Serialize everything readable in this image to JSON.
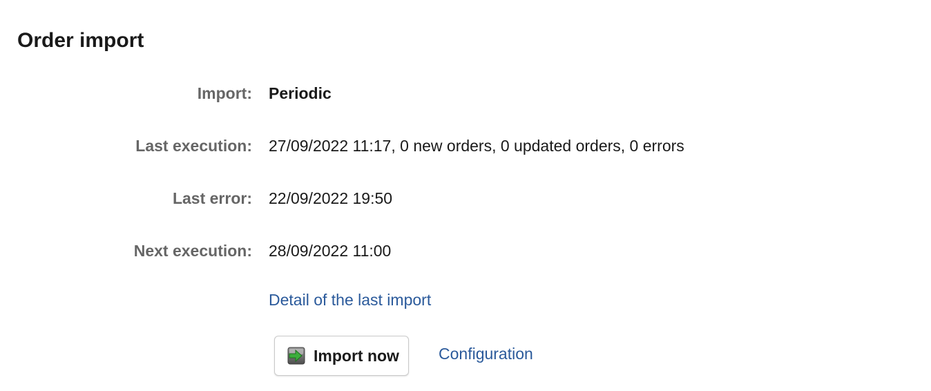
{
  "page": {
    "title": "Order import"
  },
  "fields": {
    "import": {
      "label": "Import:",
      "value": "Periodic"
    },
    "last_execution": {
      "label": "Last execution:",
      "value": "27/09/2022 11:17, 0 new orders, 0 updated orders, 0 errors"
    },
    "last_error": {
      "label": "Last error:",
      "value": "22/09/2022 19:50"
    },
    "next_execution": {
      "label": "Next execution:",
      "value": "28/09/2022 11:00"
    }
  },
  "links": {
    "detail_last_import": "Detail of the last import",
    "configuration": "Configuration"
  },
  "actions": {
    "import_now_label": "Import now",
    "import_now_icon": "import-arrow-icon"
  },
  "colors": {
    "link": "#2b5a9b",
    "label": "#666666",
    "text": "#1a1a1a"
  }
}
